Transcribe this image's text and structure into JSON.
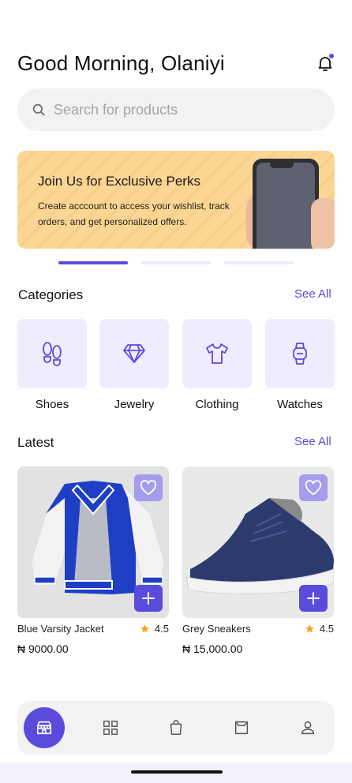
{
  "header": {
    "greeting": "Good Morning, Olaniyi"
  },
  "search": {
    "placeholder": "Search for products"
  },
  "banner": {
    "title": "Join Us for Exclusive Perks",
    "text": "Create acccount to access your wishlist, track orders, and get personalized offers.",
    "active_slide": 0
  },
  "categories": {
    "title": "Categories",
    "see_all": "See All",
    "items": [
      {
        "label": "Shoes",
        "icon": "footprints-icon"
      },
      {
        "label": "Jewelry",
        "icon": "diamond-icon"
      },
      {
        "label": "Clothing",
        "icon": "tshirt-icon"
      },
      {
        "label": "Watches",
        "icon": "watch-icon"
      }
    ]
  },
  "latest": {
    "title": "Latest",
    "see_all": "See All",
    "products": [
      {
        "name": "Blue Varsity Jacket",
        "rating": "4.5",
        "price": "₦ 9000.00"
      },
      {
        "name": "Grey Sneakers",
        "rating": "4.5",
        "price": "₦ 15,000.00"
      }
    ]
  },
  "nav": {
    "items": [
      "store-icon",
      "grid-icon",
      "shopping-bag-icon",
      "basket-icon",
      "profile-icon"
    ],
    "active": "store-icon"
  },
  "colors": {
    "accent": "#5b4bdb",
    "accent_light": "#efedfd",
    "banner": "#fcd694",
    "star": "#f5a623"
  }
}
